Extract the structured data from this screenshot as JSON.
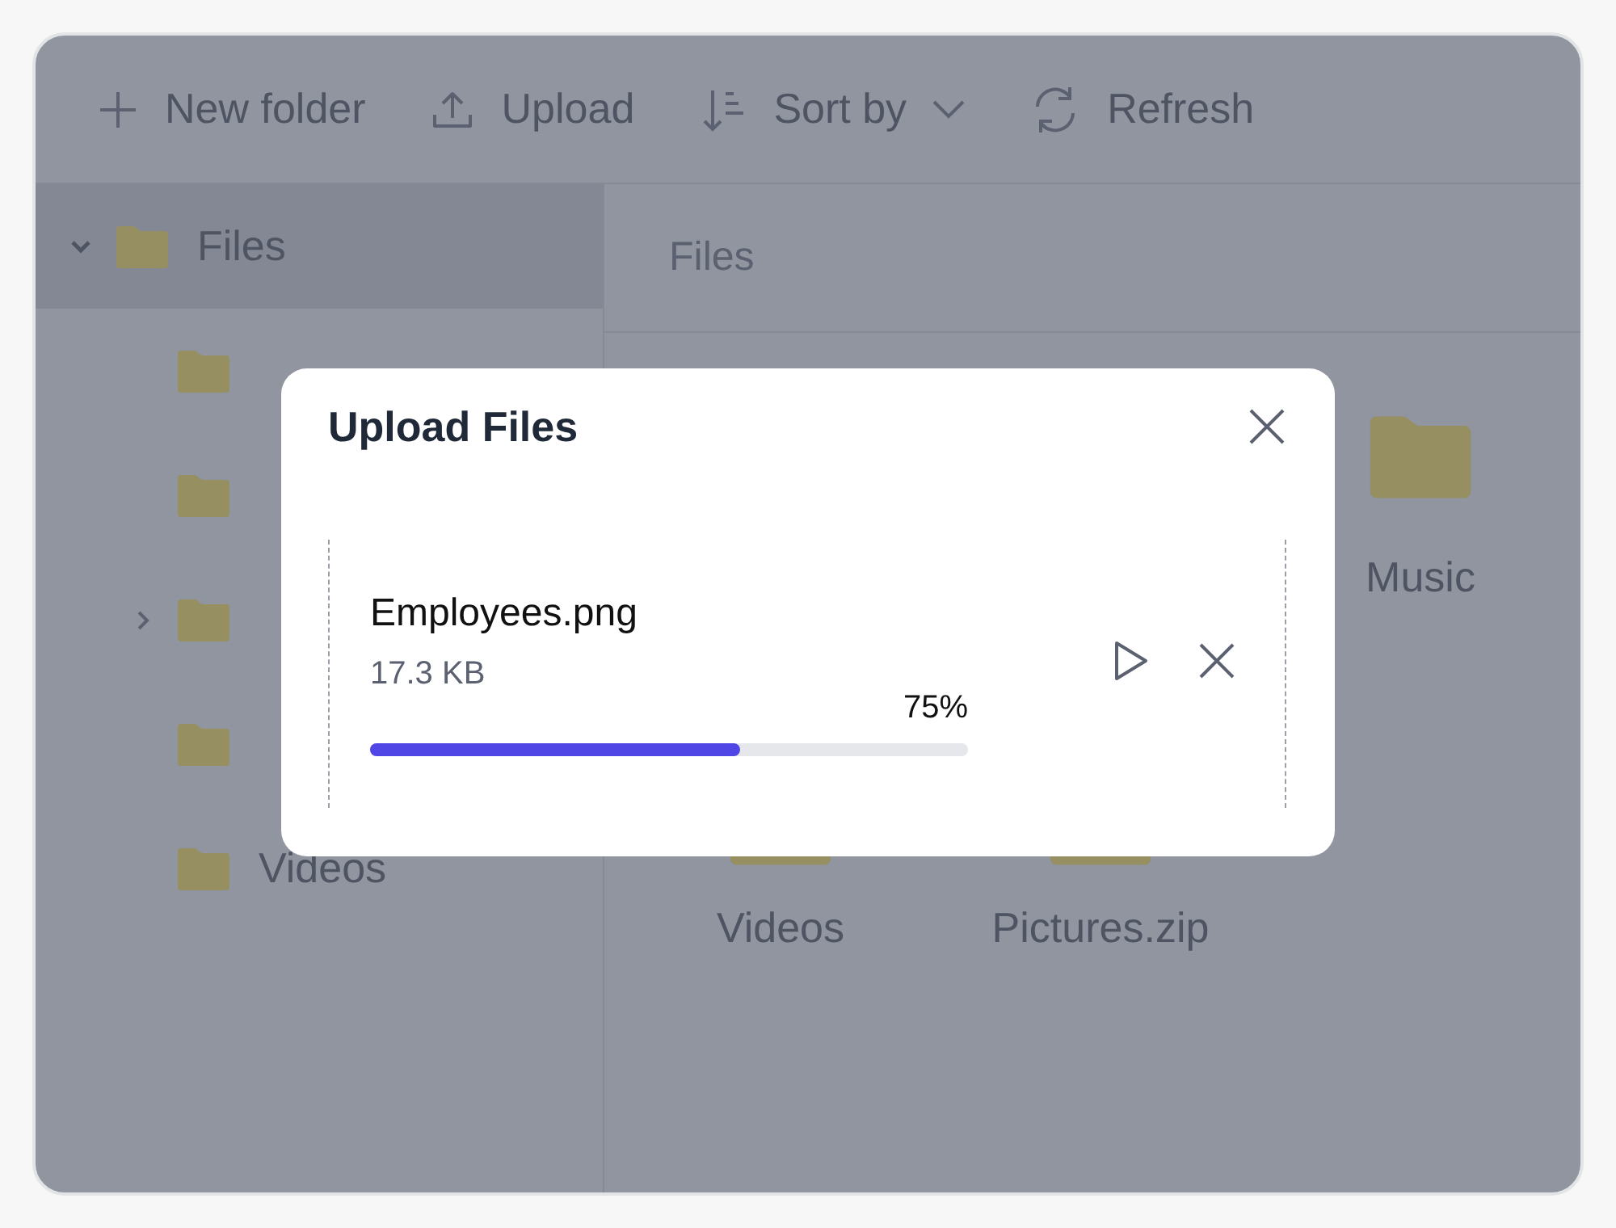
{
  "toolbar": [
    {
      "kind": "new-folder",
      "label": "New folder"
    },
    {
      "kind": "upload",
      "label": "Upload"
    },
    {
      "kind": "sort",
      "label": "Sort by"
    },
    {
      "kind": "refresh",
      "label": "Refresh"
    }
  ],
  "sidebar": {
    "items": [
      {
        "label": "Files",
        "expanded": true,
        "selected": true,
        "children": [
          {
            "selected": false
          },
          {
            "selected": false
          },
          {
            "expanded": false,
            "selected": false
          },
          {
            "selected": false
          },
          {
            "label": "Videos",
            "selected": false
          }
        ]
      }
    ]
  },
  "breadcrumb": "Files",
  "items": [
    {
      "kind": "folder",
      "label": "Music"
    },
    {
      "kind": "folder",
      "label": "Videos"
    },
    {
      "kind": "zip",
      "label": "Pictures.zip"
    }
  ],
  "dialog": {
    "title": "Upload Files",
    "files": [
      {
        "name": "Employees.png",
        "size": "17.3 KB",
        "percent": "75%",
        "level": 0.62
      }
    ]
  }
}
